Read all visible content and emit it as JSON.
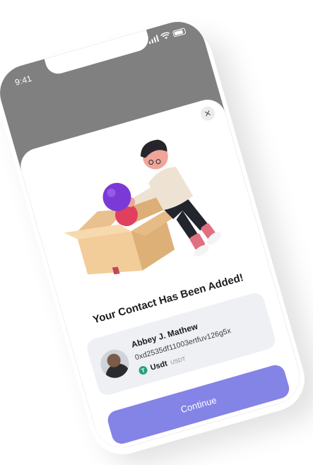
{
  "status_bar": {
    "time": "9:41"
  },
  "modal": {
    "close_icon": "close-icon",
    "title": "Your Contact Has Been Added!",
    "contact": {
      "name": "Abbey J. Mathew",
      "address": "0xd2535df11003ertfuv126g5x",
      "asset_name": "Usdt",
      "asset_ticker": "USDT",
      "asset_icon": "tether-icon",
      "asset_color": "#26A17B"
    },
    "continue_label": "Continue"
  },
  "colors": {
    "backdrop": "#808080",
    "accent": "#8483E6",
    "card": "#EEF0F4"
  }
}
